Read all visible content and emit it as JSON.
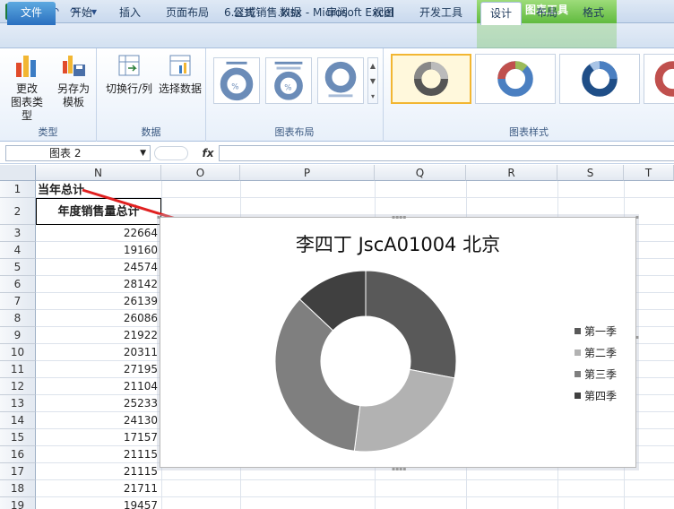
{
  "app": {
    "icon_label": "X",
    "window_title": "6.区域销售.xlsx  -  Microsoft Excel",
    "tools_header": "图表工具"
  },
  "tabs": [
    {
      "label": "文件"
    },
    {
      "label": "开始"
    },
    {
      "label": "插入"
    },
    {
      "label": "页面布局"
    },
    {
      "label": "公式"
    },
    {
      "label": "数据"
    },
    {
      "label": "审阅"
    },
    {
      "label": "视图"
    },
    {
      "label": "开发工具"
    },
    {
      "label": "设计"
    },
    {
      "label": "布局"
    },
    {
      "label": "格式"
    }
  ],
  "ribbon": {
    "change_type_l1": "更改",
    "change_type_l2": "图表类型",
    "save_template_l1": "另存为",
    "save_template_l2": "模板",
    "group_type": "类型",
    "switch_row_col": "切换行/列",
    "select_data": "选择数据",
    "group_data": "数据",
    "group_layout": "图表布局",
    "group_style": "图表样式"
  },
  "formula_bar": {
    "name_box": "图表 2",
    "fx": "fx",
    "formula": ""
  },
  "columns": [
    "N",
    "O",
    "P",
    "Q",
    "R",
    "S",
    "T"
  ],
  "rows": [
    "1",
    "2",
    "3",
    "4",
    "5",
    "6",
    "7",
    "8",
    "9",
    "10",
    "11",
    "12",
    "13",
    "14",
    "15",
    "16",
    "17",
    "18",
    "19"
  ],
  "cells": {
    "n1": "当年总计",
    "n2": "年度销售量总计",
    "values": [
      "22664",
      "19160",
      "24574",
      "28142",
      "26139",
      "26086",
      "21922",
      "20311",
      "27195",
      "21104",
      "25233",
      "24130",
      "17157",
      "21115",
      "21115",
      "21711",
      "19457"
    ]
  },
  "chart_data": {
    "type": "pie",
    "variant": "doughnut",
    "title": "李四丁 JscA01004 北京",
    "categories": [
      "第一季",
      "第二季",
      "第三季",
      "第四季"
    ],
    "values": [
      28,
      24,
      35,
      13
    ],
    "colors": [
      "#595959",
      "#b2b2b2",
      "#7f7f7f",
      "#404040"
    ],
    "legend": "right"
  }
}
